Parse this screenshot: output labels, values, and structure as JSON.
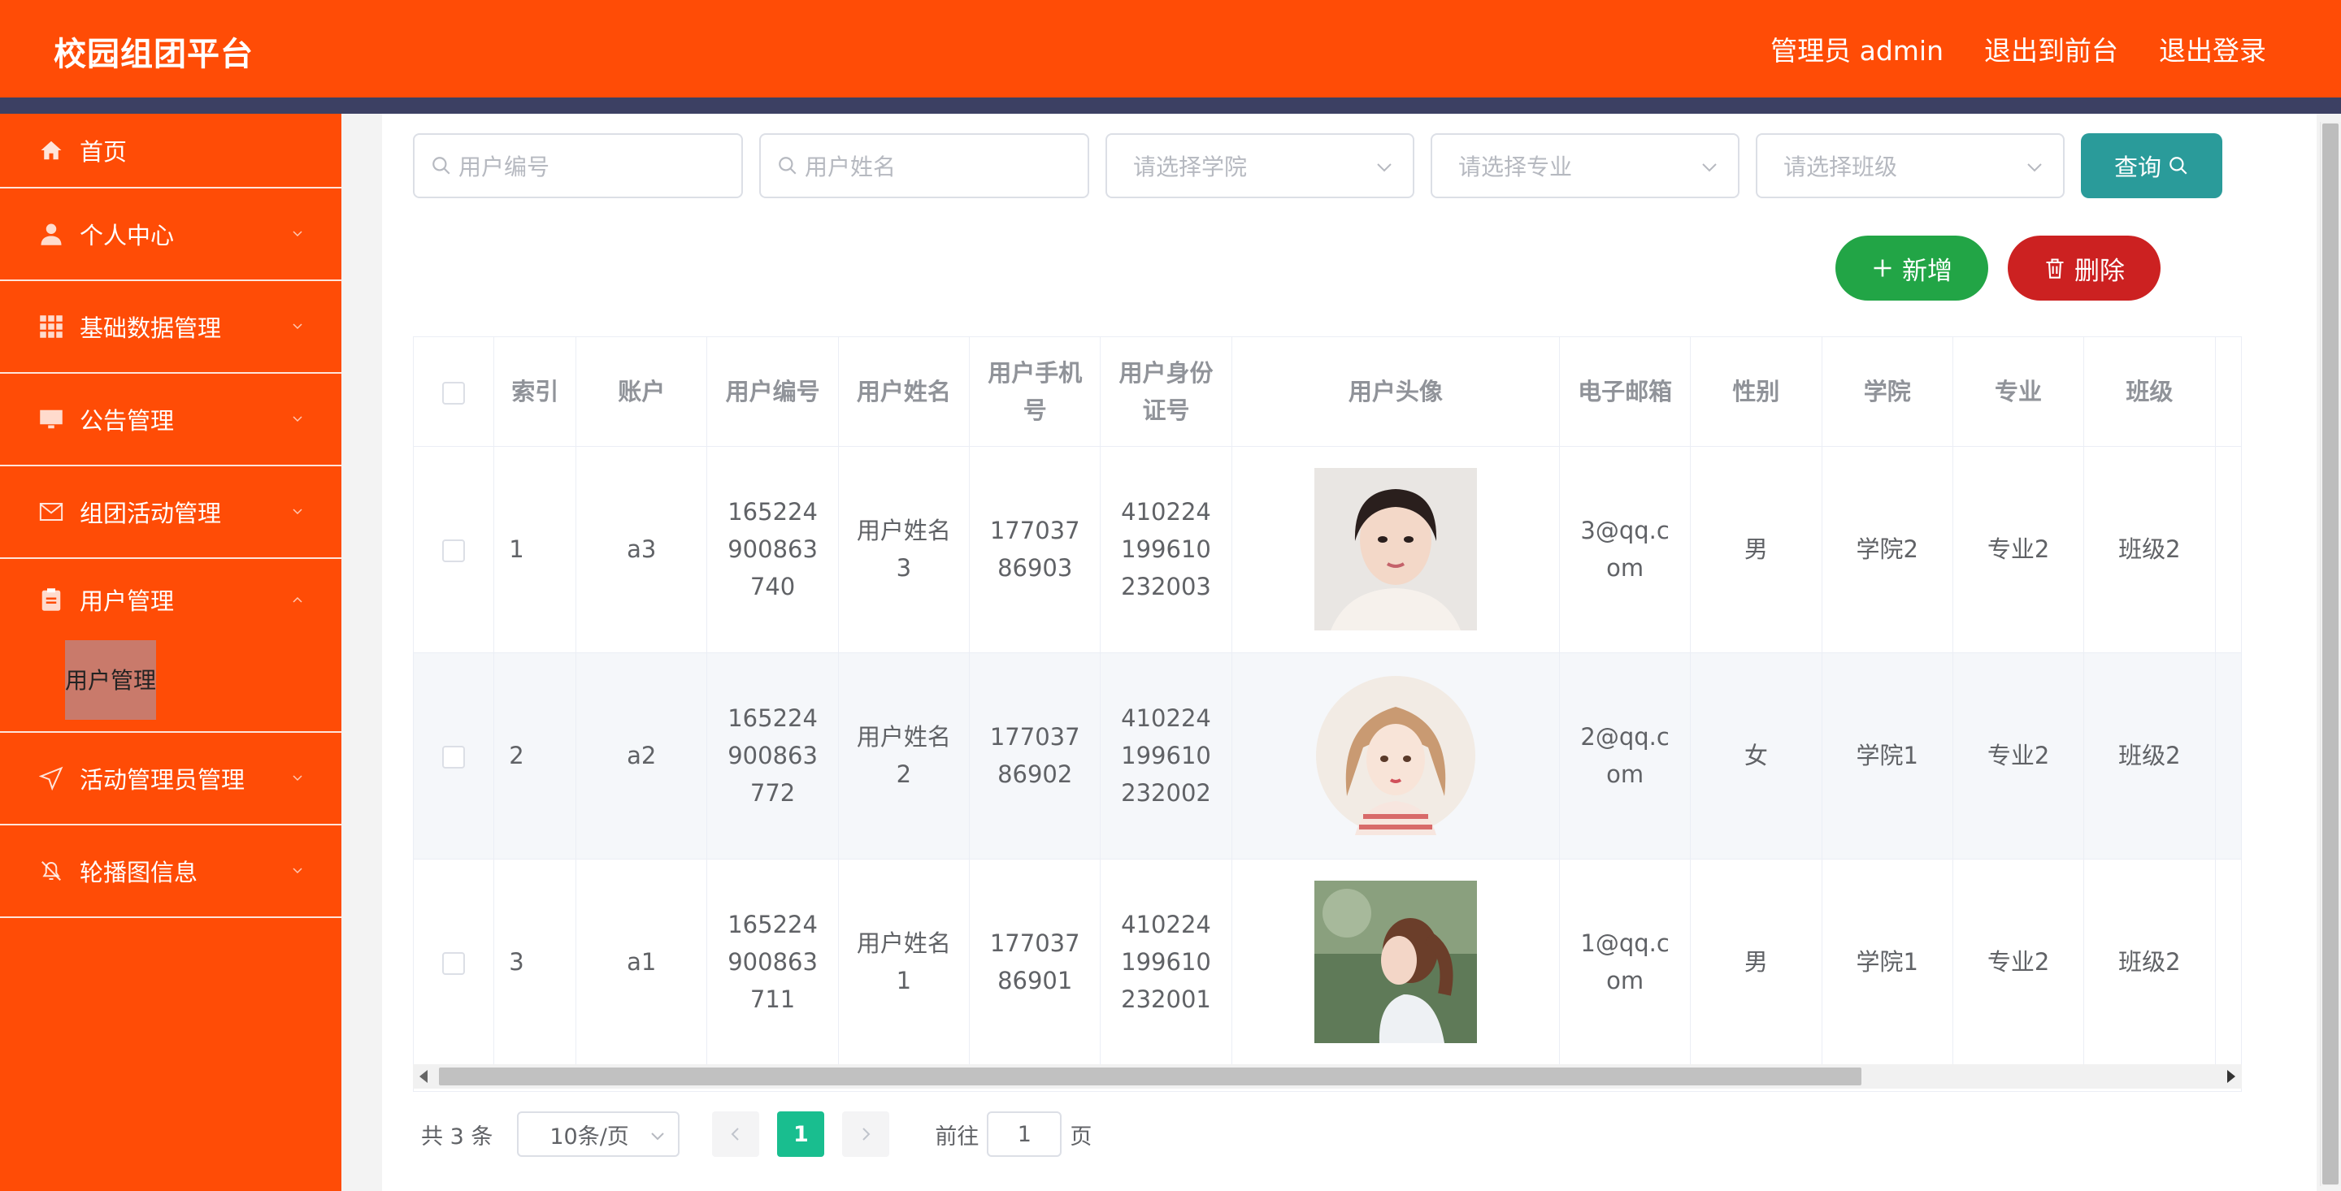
{
  "app": {
    "title": "校园组团平台"
  },
  "topnav": {
    "admin": "管理员 admin",
    "front": "退出到前台",
    "logout": "退出登录"
  },
  "sidebar": {
    "items": [
      {
        "label": "首页",
        "icon": "home-icon"
      },
      {
        "label": "个人中心",
        "icon": "user-icon"
      },
      {
        "label": "基础数据管理",
        "icon": "grid-icon"
      },
      {
        "label": "公告管理",
        "icon": "monitor-icon"
      },
      {
        "label": "组团活动管理",
        "icon": "mail-icon"
      },
      {
        "label": "用户管理",
        "icon": "clipboard-icon"
      },
      {
        "label": "活动管理员管理",
        "icon": "send-icon"
      },
      {
        "label": "轮播图信息",
        "icon": "bell-off-icon"
      }
    ],
    "sub_active": "用户管理"
  },
  "filters": {
    "user_no": "用户编号",
    "user_name": "用户姓名",
    "college": "请选择学院",
    "major": "请选择专业",
    "class": "请选择班级",
    "query": "查询"
  },
  "actions": {
    "add": "新增",
    "delete": "删除"
  },
  "table": {
    "headers": [
      "索引",
      "账户",
      "用户编号",
      "用户姓名",
      "用户手机号",
      "用户身份证号",
      "用户头像",
      "电子邮箱",
      "性别",
      "学院",
      "专业",
      "班级"
    ],
    "rows": [
      {
        "index": "1",
        "account": "a3",
        "no": "16522490086374​0",
        "name": "用户姓名3",
        "phone": "17703786903",
        "idcard": "410224199610232003",
        "avatar": "avatar-woman-portrait",
        "email": "3@qq.com",
        "gender": "男",
        "college": "学院2",
        "major": "专业2",
        "class": "班级2"
      },
      {
        "index": "2",
        "account": "a2",
        "no": "165224900863772",
        "name": "用户姓名2",
        "phone": "17703786902",
        "idcard": "410224199610232002",
        "avatar": "avatar-illustrated-girl",
        "email": "2@qq.com",
        "gender": "女",
        "college": "学院1",
        "major": "专业2",
        "class": "班级2"
      },
      {
        "index": "3",
        "account": "a1",
        "no": "165224900863711",
        "name": "用户姓名1",
        "phone": "17703786901",
        "idcard": "410224199610232001",
        "avatar": "avatar-girl-profile",
        "email": "1@qq.com",
        "gender": "男",
        "college": "学院1",
        "major": "专业2",
        "class": "班级2"
      }
    ]
  },
  "pagination": {
    "total": "共 3 条",
    "page_size": "10条/页",
    "current": "1",
    "goto_label": "前往",
    "goto_value": "1",
    "page_suffix": "页"
  },
  "colors": {
    "brand": "#ff4c06",
    "stripe": "#3c4063",
    "query": "#2a9b9a",
    "add": "#22a546",
    "delete": "#cc2121",
    "current_page": "#19be8f"
  }
}
